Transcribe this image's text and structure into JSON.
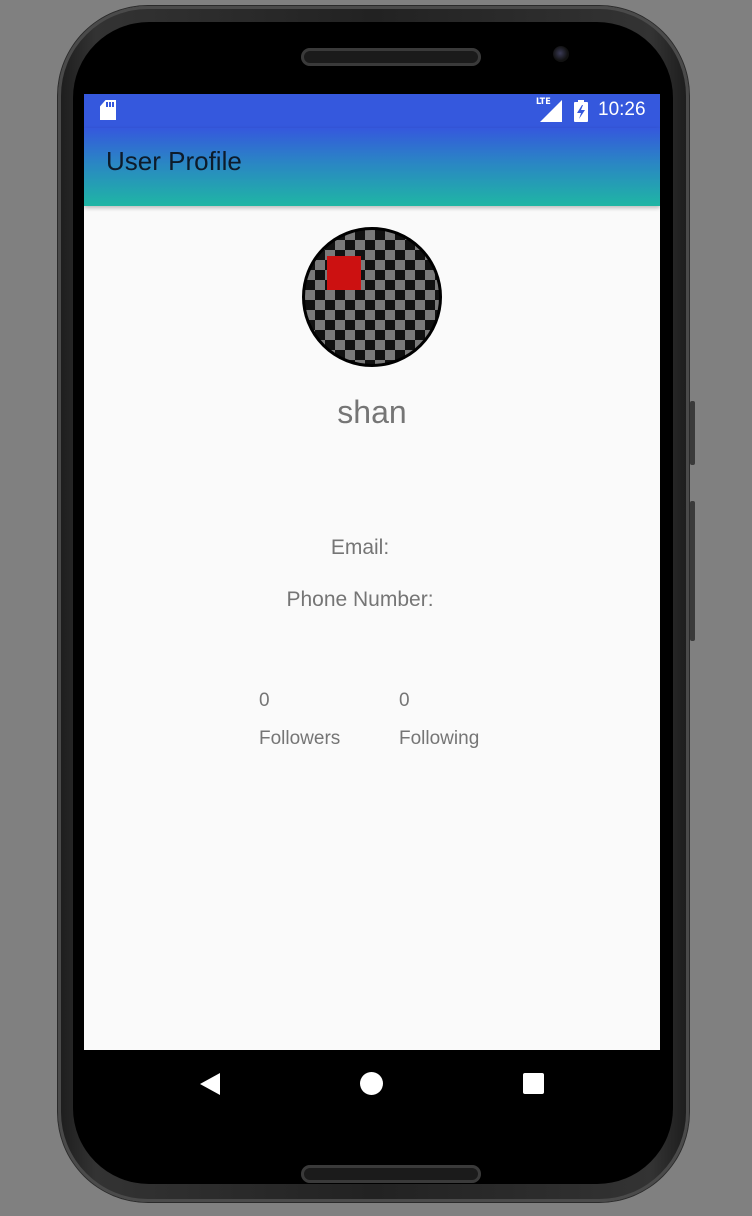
{
  "status_bar": {
    "network_label": "LTE",
    "time": "10:26",
    "icons": [
      "sd-card-icon",
      "signal-icon",
      "battery-charging-icon"
    ]
  },
  "app_bar": {
    "title": "User Profile"
  },
  "profile": {
    "avatar": "avatar-image",
    "username": "shan",
    "email_label": "Email:",
    "phone_label": "Phone Number:",
    "followers_count": "0",
    "followers_label": "Followers",
    "following_count": "0",
    "following_label": "Following"
  },
  "nav_bar": {
    "icons": [
      "back-icon",
      "home-icon",
      "recent-apps-icon"
    ]
  },
  "colors": {
    "appbar_top": "#3558dd",
    "appbar_bottom": "#1fb6a4",
    "text_gray": "#757575",
    "avatar_accent": "#cc1111"
  }
}
